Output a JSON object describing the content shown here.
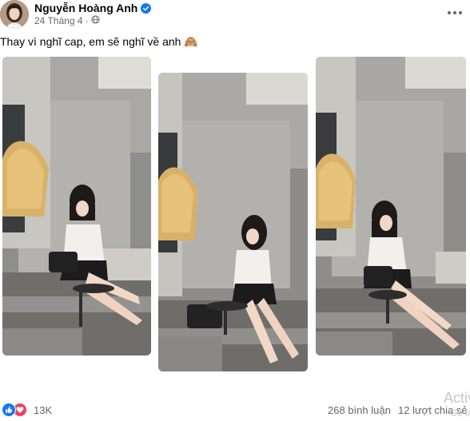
{
  "post": {
    "author": "Nguyễn Hoàng Anh",
    "date": "24 Tháng 4",
    "privacy_icon": "globe-icon",
    "caption": "Thay vì nghĩ cap, em sẽ nghĩ về anh 🙈"
  },
  "stats": {
    "reaction_icons": [
      "like-icon",
      "love-icon"
    ],
    "reaction_count": "13K",
    "comments": "268 bình luận",
    "shares": "12 lượt chia sẻ"
  },
  "watermark": {
    "line1": "Activ",
    "line2": "Go to"
  },
  "colors": {
    "like": "#1877f2",
    "love": "#f33e58",
    "verified": "#1877f2",
    "meta_text": "#65676b"
  }
}
